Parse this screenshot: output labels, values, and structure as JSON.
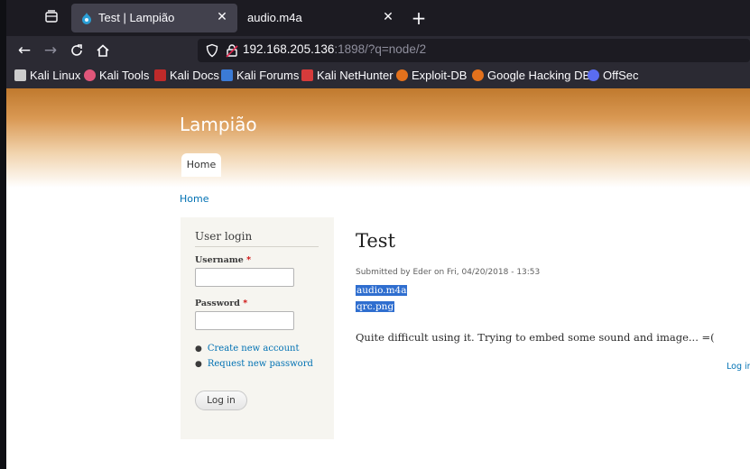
{
  "browser": {
    "tabs": [
      {
        "title": "Test | Lampião",
        "active": true
      },
      {
        "title": "audio.m4a",
        "active": false
      }
    ],
    "url": {
      "host": "192.168.205.136",
      "rest": ":1898/?q=node/2"
    },
    "bookmarks": [
      {
        "label": "Kali Linux",
        "icon": "kali-dragon-icon",
        "color": "#cccccc"
      },
      {
        "label": "Kali Tools",
        "icon": "kali-tools-icon",
        "color": "#e0567a"
      },
      {
        "label": "Kali Docs",
        "icon": "kali-docs-icon",
        "color": "#c02a2a"
      },
      {
        "label": "Kali Forums",
        "icon": "kali-forums-icon",
        "color": "#3b7bd6"
      },
      {
        "label": "Kali NetHunter",
        "icon": "nethunter-icon",
        "color": "#d63b3b"
      },
      {
        "label": "Exploit-DB",
        "icon": "exploit-db-icon",
        "color": "#e3711c"
      },
      {
        "label": "Google Hacking DB",
        "icon": "ghdb-icon",
        "color": "#e3711c"
      },
      {
        "label": "OffSec",
        "icon": "offsec-icon",
        "color": "#5a6cf0"
      }
    ]
  },
  "site": {
    "name": "Lampião",
    "nav_home": "Home",
    "breadcrumb": "Home"
  },
  "sidebar": {
    "title": "User login",
    "username_label": "Username",
    "password_label": "Password",
    "required_mark": "*",
    "links": [
      "Create new account",
      "Request new password"
    ],
    "login_button": "Log in"
  },
  "node": {
    "title": "Test",
    "submitted": "Submitted by Eder on Fri, 04/20/2018 - 13:53",
    "attachments": [
      "audio.m4a",
      "qrc.png"
    ],
    "body": "Quite difficult using it. Trying to embed some sound and image... =(",
    "login_link": "Log in"
  },
  "colors": {
    "link": "#0071b3",
    "selection": "#2f6ecf",
    "header_orange": "#c07a2e"
  }
}
